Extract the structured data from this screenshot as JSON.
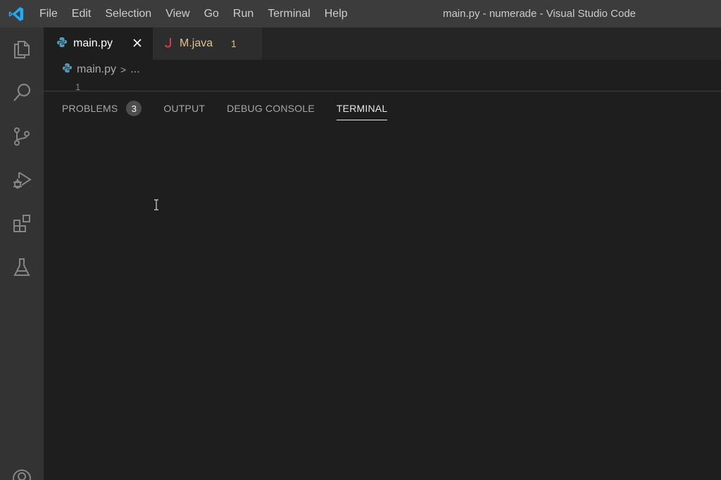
{
  "titlebar": {
    "menu": [
      "File",
      "Edit",
      "Selection",
      "View",
      "Go",
      "Run",
      "Terminal",
      "Help"
    ],
    "window_title": "main.py - numerade - Visual Studio Code"
  },
  "activitybar": {
    "icons": [
      "explorer-icon",
      "search-icon",
      "source-control-icon",
      "run-debug-icon",
      "extensions-icon",
      "testing-icon",
      "account-icon"
    ]
  },
  "tabs": [
    {
      "label": "main.py",
      "icon": "python-icon",
      "active": true
    },
    {
      "label": "M.java",
      "icon": "java-icon",
      "active": false,
      "problems": "1"
    }
  ],
  "breadcrumb": {
    "file": "main.py",
    "separator": ">",
    "rest": "..."
  },
  "editor": {
    "line_number": "1"
  },
  "panel": {
    "tabs": [
      {
        "label": "PROBLEMS",
        "count": "3"
      },
      {
        "label": "OUTPUT"
      },
      {
        "label": "DEBUG CONSOLE"
      },
      {
        "label": "TERMINAL",
        "active": true
      }
    ]
  },
  "colors": {
    "titlebar": "#3c3c3c",
    "activitybar": "#333333",
    "editor_bg": "#1e1e1e",
    "vscode_blue": "#23a9f2",
    "python_blue": "#519aba",
    "java_red": "#cc3e44",
    "modified_yellow": "#e2c08d"
  }
}
